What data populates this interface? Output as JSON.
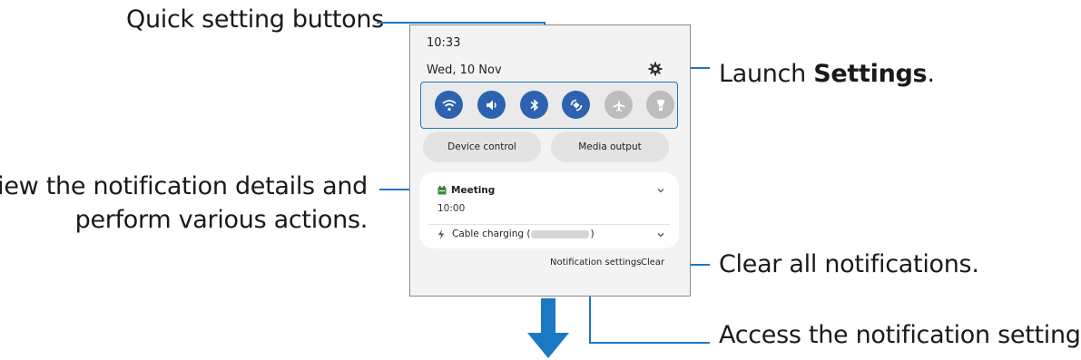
{
  "callouts": {
    "quick_settings": "Quick setting buttons",
    "view_details_line1": "View the notification details and",
    "view_details_line2": "perform various actions.",
    "launch_settings_prefix": "Launch ",
    "launch_settings_bold": "Settings",
    "launch_settings_suffix": ".",
    "clear_all": "Clear all notifications.",
    "access_settings": "Access the notification settings."
  },
  "phone": {
    "time": "10:33",
    "date": "Wed, 10 Nov",
    "quick_settings": [
      {
        "icon": "wifi-icon",
        "active": true
      },
      {
        "icon": "sound-icon",
        "active": true
      },
      {
        "icon": "bluetooth-icon",
        "active": true
      },
      {
        "icon": "auto-rotate-icon",
        "active": true
      },
      {
        "icon": "airplane-icon",
        "active": false
      },
      {
        "icon": "flashlight-icon",
        "active": false
      }
    ],
    "device_control": "Device control",
    "media_output": "Media output",
    "notifications": {
      "meeting_title": "Meeting",
      "meeting_time": "10:00",
      "charging_prefix": "Cable charging (",
      "charging_suffix": ")"
    },
    "notification_settings": "Notification settings",
    "clear": "Clear"
  },
  "colors": {
    "accent": "#1b78c4",
    "qs_active": "#2d62b0",
    "qs_inactive": "#bdbdbd"
  }
}
